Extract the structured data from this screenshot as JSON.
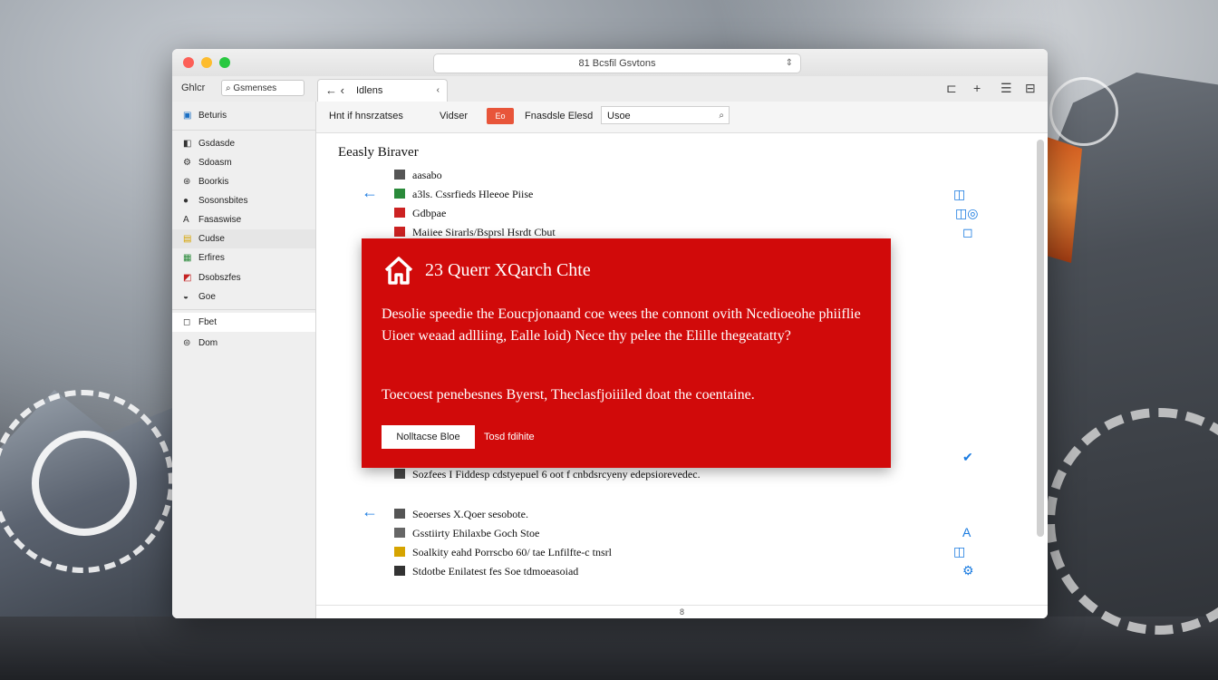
{
  "window": {
    "url": "81 Bcsfil Gsvtons",
    "url_arrow": "⇕"
  },
  "toolbar": {
    "label": "Ghlcr",
    "search_value": "Gsmenses",
    "tab_back": "← ‹",
    "tab_title": "Idlens",
    "tab_close": "‹",
    "icons": [
      "sidebar-icon",
      "plus-icon",
      "list-icon",
      "grid-icon"
    ],
    "icon_glyphs": [
      "⊏",
      "+",
      "☰",
      "⊟"
    ]
  },
  "sidebar": {
    "items": [
      {
        "icon": "▣",
        "label": "Beturis"
      },
      {
        "icon": "◧",
        "label": "Gsdasde"
      },
      {
        "icon": "⚙",
        "label": "Sdoasm"
      },
      {
        "icon": "⊛",
        "label": "Boorkis"
      },
      {
        "icon": "●",
        "label": "Sosonsbites"
      },
      {
        "icon": "A",
        "label": "Fasaswise"
      },
      {
        "icon": "▤",
        "label": "Cudse"
      },
      {
        "icon": "▦",
        "label": "Erfires"
      },
      {
        "icon": "◩",
        "label": "Dsobszfes"
      },
      {
        "icon": "◒",
        "label": "Goe"
      },
      {
        "icon": "◻",
        "label": "Fbet"
      },
      {
        "icon": "⊜",
        "label": "Dom"
      }
    ]
  },
  "filterbar": {
    "f1": "Hnt if hnsrzatses",
    "f2": "Vidser",
    "f3": "Eo",
    "f4": "Fnasdsle Elesd",
    "search_value": "Usoe"
  },
  "list": {
    "title": "Eeasly Biraver",
    "rows_top": [
      {
        "icon_color": "#555",
        "text": "aasabo"
      },
      {
        "icon_color": "#2a8a3a",
        "text": "a3ls. Cssrfieds Hleeoe Piise"
      },
      {
        "icon_color": "#cc2222",
        "text": "Gdbpae"
      },
      {
        "icon_color": "#cc2222",
        "text": "Maiiee Sirarls/Bsprsl Hsrdt Cbut"
      }
    ],
    "row_mid": "Sozfees I Fiddesp cdstyepuel 6 oot f cnbdsrcyeny edepsiorevedec.",
    "rows_bottom": [
      {
        "icon_color": "#555",
        "text": "Seoerses X.Qoer sesobote."
      },
      {
        "icon_color": "#666",
        "text": "Gsstiirty Ehilaxbe Goch Stoe"
      },
      {
        "icon_color": "#d6a400",
        "text": "Soalkity eahd Porrscbo 60/ tae Lnfilfte-c tnsrl"
      },
      {
        "icon_color": "#333",
        "text": "Stdotbe Enilatest fes Soe tdmoeasoiad"
      }
    ],
    "right_icons": [
      "◫",
      "◫◎",
      "◻",
      "✔",
      "A",
      "◫",
      "⚙"
    ]
  },
  "modal": {
    "title": "23 Querr XQarch Chte",
    "body1": "Desolie speedie the Eoucpjonaand coe wees the connont ovith Ncedioeohe phiiflie Uioer weaad adlliing, Ealle loid) Nece thy pelee the Elille thegeatatty?",
    "body2": "Toecoest penebesnes Byerst, Theclasfjoiiiled doat the coentaine.",
    "primary_button": "Nolltacse Bloe",
    "secondary_button": "Tosd fdihite"
  },
  "statusbar": {
    "text": "8"
  }
}
